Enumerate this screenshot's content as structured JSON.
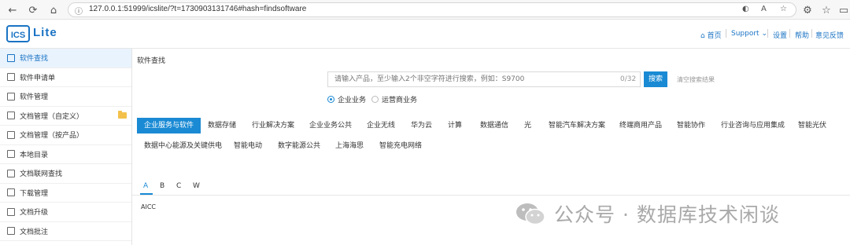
{
  "browser": {
    "url": "127.0.0.1:51999/icslite/?t=1730903131746#hash=findsoftware"
  },
  "header": {
    "logo_text": "Lite",
    "logo_mark": "ICS",
    "links": [
      "首页",
      "Support",
      "设置",
      "帮助",
      "意见反馈"
    ]
  },
  "sidebar": {
    "items": [
      {
        "label": "软件查找",
        "icon": "search-doc-icon"
      },
      {
        "label": "软件申请单",
        "icon": "edit-doc-icon"
      },
      {
        "label": "软件管理",
        "icon": "grid-icon"
      },
      {
        "label": "文档管理（自定义）",
        "icon": "edit-doc-icon"
      },
      {
        "label": "文档管理（按产品）",
        "icon": "edit-doc-icon"
      },
      {
        "label": "本地目录",
        "icon": "tree-icon"
      },
      {
        "label": "文档联网查找",
        "icon": "search-doc-icon"
      },
      {
        "label": "下载管理",
        "icon": "download-icon"
      },
      {
        "label": "文档升级",
        "icon": "upgrade-icon"
      },
      {
        "label": "文档批注",
        "icon": "comment-icon"
      }
    ]
  },
  "main": {
    "title": "软件查找",
    "search_placeholder": "请输入产品，至少输入2个非空字符进行搜索，例如：S9700",
    "search_count": "0/32",
    "search_button": "搜索",
    "clear_label": "清空搜索结果",
    "radios": [
      {
        "label": "企业业务",
        "checked": true
      },
      {
        "label": "运营商业务",
        "checked": false
      }
    ],
    "categories_row1": [
      "企业服务与软件",
      "数据存储",
      "行业解决方案",
      "企业业务公共",
      "企业无线",
      "华为云",
      "计算",
      "数据通信",
      "光",
      "智能汽车解决方案",
      "终端商用产品",
      "智能协作",
      "行业咨询与应用集成",
      "智能光伏"
    ],
    "categories_row2": [
      "数据中心能源及关键供电",
      "智能电动",
      "数字能源公共",
      "上海海思",
      "智能充电网络"
    ],
    "letters": [
      "A",
      "B",
      "C",
      "W"
    ],
    "result": "AICC"
  },
  "watermark": {
    "text": "公众号 · 数据库技术闲谈"
  },
  "colors": {
    "accent": "#1a8ad4",
    "brand": "#1a73c4"
  }
}
